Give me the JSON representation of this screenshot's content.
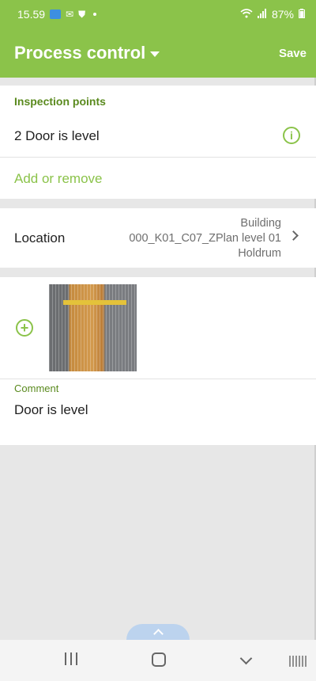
{
  "status_bar": {
    "time": "15.59",
    "battery": "87%",
    "icons": [
      "app-icon",
      "gmail-icon",
      "shield-icon",
      "wifi-icon",
      "signal-icon",
      "battery-icon"
    ]
  },
  "app_bar": {
    "title": "Process control",
    "save_label": "Save"
  },
  "inspection": {
    "label": "Inspection points",
    "item": "2 Door is level",
    "info_glyph": "i",
    "add_remove": "Add or remove"
  },
  "location": {
    "label": "Location",
    "line1": "Building",
    "line2": "000_K01_C07_ZPlan level 01",
    "line3": "Holdrum"
  },
  "media": {
    "add_glyph": "+"
  },
  "comment": {
    "label": "Comment",
    "text": "Door is level"
  },
  "colors": {
    "accent": "#8bc34a",
    "label_green": "#5a8a1e"
  }
}
